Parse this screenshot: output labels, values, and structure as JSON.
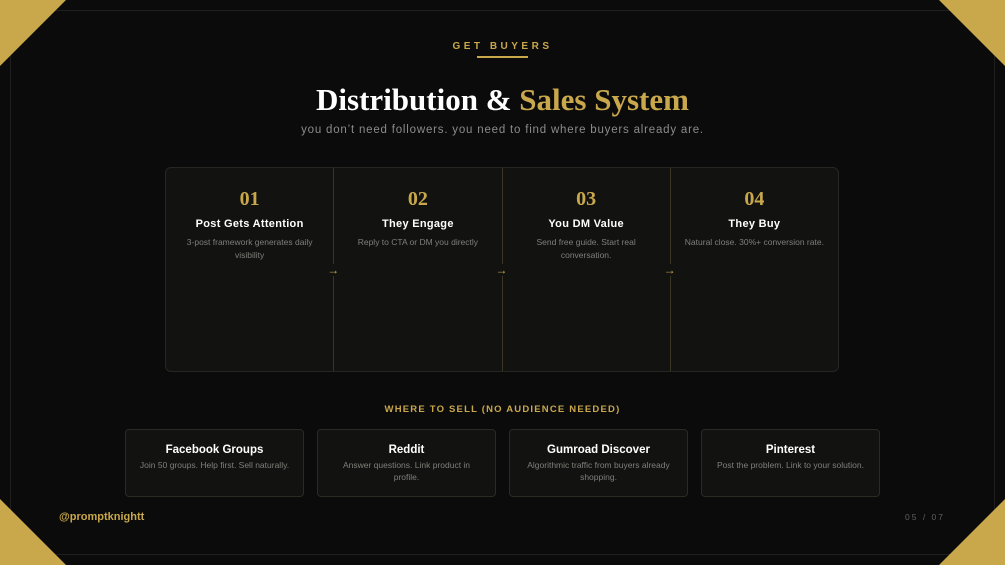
{
  "header": {
    "eyebrow": "GET BUYERS",
    "title_main": "Distribution & ",
    "title_accent": "Sales System",
    "subtitle": "you don’t need followers. you need to find where buyers already are."
  },
  "steps": [
    {
      "number": "01",
      "title": "Post Gets Attention",
      "desc": "3-post framework generates daily visibility",
      "arrow": "→"
    },
    {
      "number": "02",
      "title": "They Engage",
      "desc": "Reply to CTA or DM you directly",
      "arrow": "→"
    },
    {
      "number": "03",
      "title": "You DM Value",
      "desc": "Send free guide. Start real conversation.",
      "arrow": "→"
    },
    {
      "number": "04",
      "title": "They Buy",
      "desc": "Natural close. 30%+ conversion rate."
    }
  ],
  "where_to_sell": {
    "label": "WHERE TO SELL (NO AUDIENCE NEEDED)",
    "channels": [
      {
        "name": "Facebook Groups",
        "desc": "Join 50 groups. Help first. Sell naturally."
      },
      {
        "name": "Reddit",
        "desc": "Answer questions. Link product in profile."
      },
      {
        "name": "Gumroad Discover",
        "desc": "Algorithmic traffic from buyers already shopping."
      },
      {
        "name": "Pinterest",
        "desc": "Post the problem. Link to your solution."
      }
    ]
  },
  "footer": {
    "handle": "@promptknightt",
    "page": "05 / 07"
  },
  "colors": {
    "accent": "#c9a84c",
    "background": "#0b0b0b",
    "card": "#121210"
  }
}
